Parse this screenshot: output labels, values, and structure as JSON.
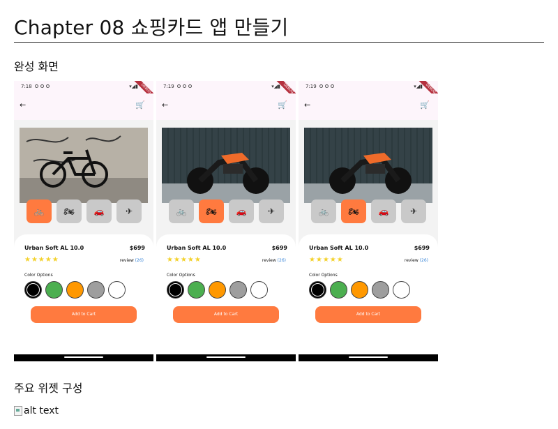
{
  "document": {
    "title": "Chapter 08 쇼핑카드 앱 만들기",
    "section_result": "완성 화면",
    "section_widgets": "주요 위젯 구성",
    "broken_image_alt": "alt text"
  },
  "phones": [
    {
      "time": "7:18",
      "photo": "bicycle",
      "selected_category": "bicycle"
    },
    {
      "time": "7:19",
      "photo": "motorcycle",
      "selected_category": "motorcycle"
    },
    {
      "time": "7:19",
      "photo": "motorcycle",
      "selected_category": "motorcycle"
    }
  ],
  "product": {
    "name": "Urban Soft AL 10.0",
    "price": "$699",
    "stars": "★★★★★",
    "review_label": "review",
    "review_count": "(26)",
    "color_options_label": "Color Options",
    "colors": [
      "#000000",
      "#4caf50",
      "#ff9800",
      "#9e9e9e",
      "#ffffff"
    ],
    "add_to_cart": "Add to Cart",
    "debug_banner": "DEBUG"
  },
  "categories": [
    {
      "name": "bicycle",
      "glyph": "🚲"
    },
    {
      "name": "motorcycle",
      "glyph": "🏍"
    },
    {
      "name": "car",
      "glyph": "🚗"
    },
    {
      "name": "airplane",
      "glyph": "✈"
    }
  ],
  "icons": {
    "back": "←",
    "cart": "🛒",
    "status_right": "▾◢▮"
  },
  "accent": "#ff7a3f"
}
